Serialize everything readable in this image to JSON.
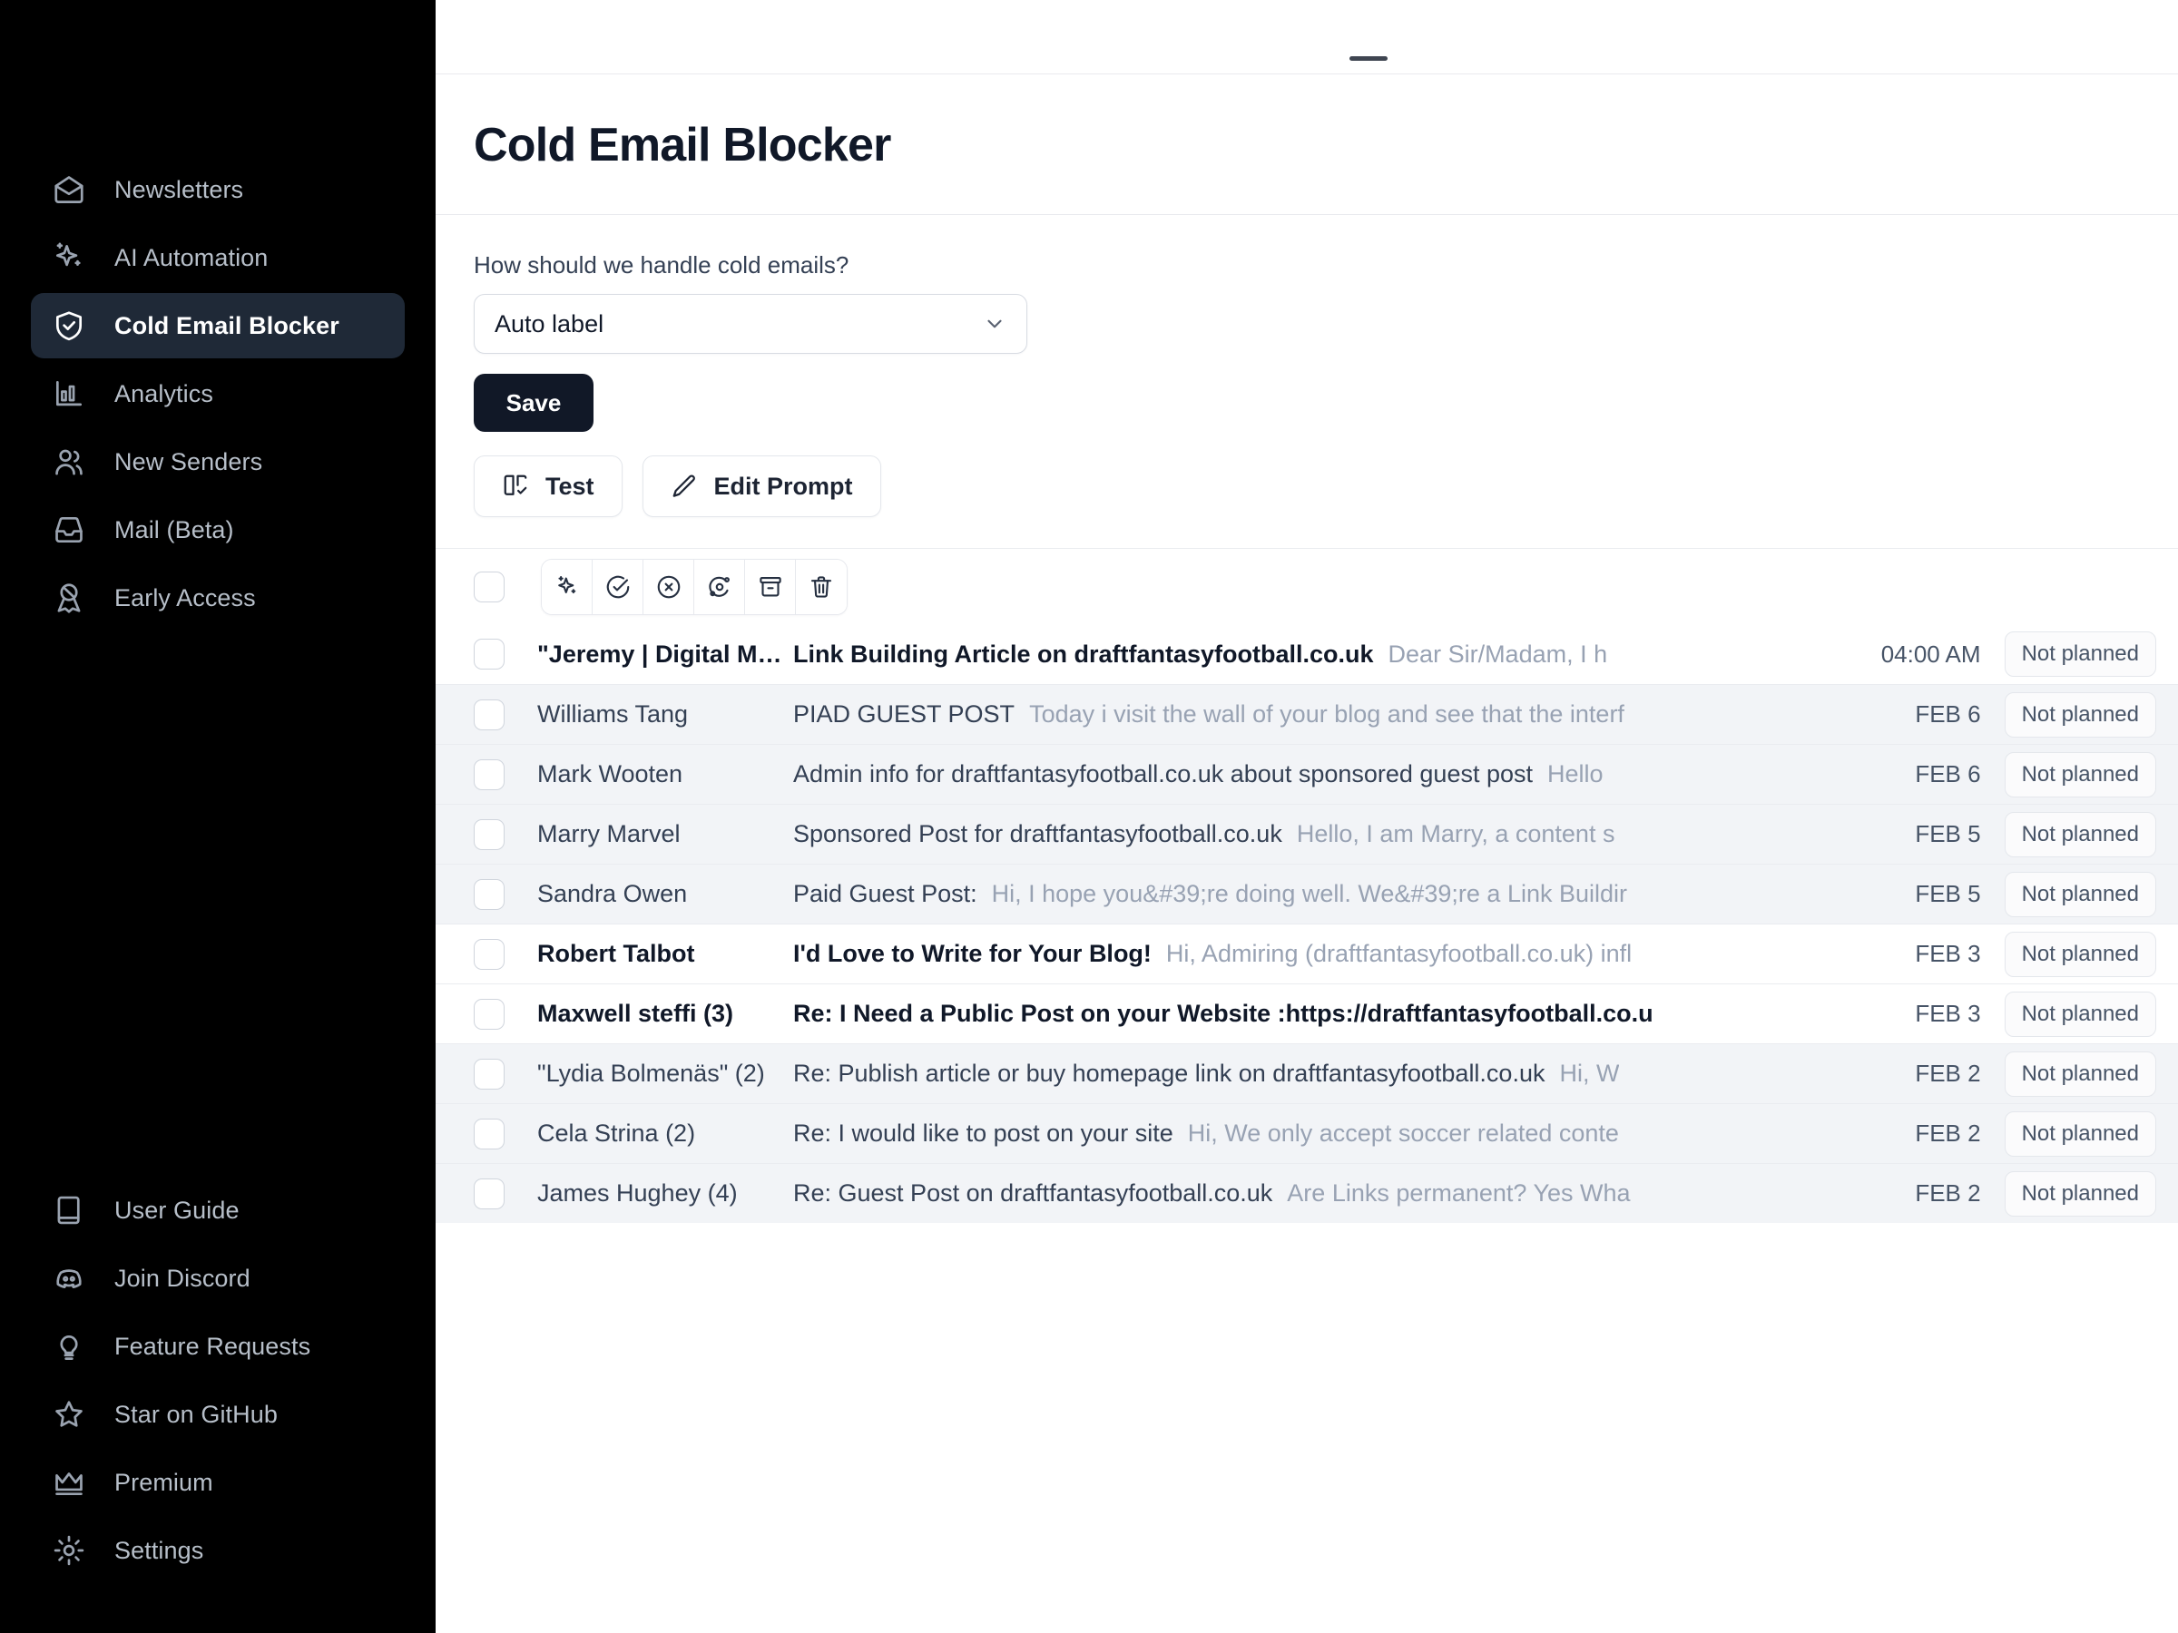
{
  "sidebar": {
    "top_items": [
      {
        "label": "Newsletters",
        "icon": "mail-open-icon",
        "active": false
      },
      {
        "label": "AI Automation",
        "icon": "sparkles-icon",
        "active": false
      },
      {
        "label": "Cold Email Blocker",
        "icon": "shield-check-icon",
        "active": true
      },
      {
        "label": "Analytics",
        "icon": "bar-chart-icon",
        "active": false
      },
      {
        "label": "New Senders",
        "icon": "users-icon",
        "active": false
      },
      {
        "label": "Mail (Beta)",
        "icon": "inbox-icon",
        "active": false
      },
      {
        "label": "Early Access",
        "icon": "ribbon-icon",
        "active": false
      }
    ],
    "bottom_items": [
      {
        "label": "User Guide",
        "icon": "book-icon"
      },
      {
        "label": "Join Discord",
        "icon": "discord-icon"
      },
      {
        "label": "Feature Requests",
        "icon": "lightbulb-icon"
      },
      {
        "label": "Star on GitHub",
        "icon": "star-icon"
      },
      {
        "label": "Premium",
        "icon": "crown-icon"
      },
      {
        "label": "Settings",
        "icon": "gear-icon"
      }
    ]
  },
  "header": {
    "title": "Cold Email Blocker"
  },
  "controls": {
    "field_label": "How should we handle cold emails?",
    "select_value": "Auto label",
    "select_options": [
      "Auto label"
    ],
    "save_label": "Save",
    "test_label": "Test",
    "edit_prompt_label": "Edit Prompt"
  },
  "toolbar": {
    "select_all_checked": false,
    "actions": [
      {
        "name": "ai-categorize-icon",
        "title": "AI"
      },
      {
        "name": "mark-done-icon",
        "title": "Mark done"
      },
      {
        "name": "mark-not-done-icon",
        "title": "Not done"
      },
      {
        "name": "mark-spam-icon",
        "title": "Spam"
      },
      {
        "name": "archive-icon",
        "title": "Archive"
      },
      {
        "name": "trash-icon",
        "title": "Delete"
      }
    ]
  },
  "emails": [
    {
      "sender": "\"Jeremy | Digital Mastermi...",
      "subject": "Link Building Article on draftfantasyfootball.co.uk",
      "snippet": "Dear Sir/Madam, I h",
      "date": "04:00 AM",
      "status": "Not planned",
      "unread": true,
      "shaded": false
    },
    {
      "sender": "Williams Tang",
      "subject": "PIAD GUEST POST",
      "snippet": "Today i visit the wall of your blog and see that the interf",
      "date": "FEB 6",
      "status": "Not planned",
      "unread": false,
      "shaded": true
    },
    {
      "sender": "Mark Wooten",
      "subject": "Admin info for draftfantasyfootball.co.uk about sponsored guest post",
      "snippet": "Hello",
      "date": "FEB 6",
      "status": "Not planned",
      "unread": false,
      "shaded": true
    },
    {
      "sender": "Marry Marvel",
      "subject": "Sponsored Post for draftfantasyfootball.co.uk",
      "snippet": "Hello, I am Marry, a content s",
      "date": "FEB 5",
      "status": "Not planned",
      "unread": false,
      "shaded": true
    },
    {
      "sender": "Sandra Owen",
      "subject": "Paid Guest Post:",
      "snippet": "Hi, I hope you&#39;re doing well. We&#39;re a Link Buildir",
      "date": "FEB 5",
      "status": "Not planned",
      "unread": false,
      "shaded": true
    },
    {
      "sender": "Robert Talbot",
      "subject": "I'd Love to Write for Your Blog!",
      "snippet": "Hi, Admiring (draftfantasyfootball.co.uk) infl",
      "date": "FEB 3",
      "status": "Not planned",
      "unread": true,
      "shaded": false
    },
    {
      "sender": "Maxwell steffi (3)",
      "subject": "Re: I Need a Public Post on your Website :https://draftfantasyfootball.co.u",
      "snippet": "",
      "date": "FEB 3",
      "status": "Not planned",
      "unread": true,
      "shaded": false
    },
    {
      "sender": "\"Lydia Bolmenäs\" (2)",
      "subject": "Re: Publish article or buy homepage link on draftfantasyfootball.co.uk",
      "snippet": "Hi, W",
      "date": "FEB 2",
      "status": "Not planned",
      "unread": false,
      "shaded": true
    },
    {
      "sender": "Cela Strina (2)",
      "subject": "Re: I would like to post on your site",
      "snippet": "Hi, We only accept soccer related conte",
      "date": "FEB 2",
      "status": "Not planned",
      "unread": false,
      "shaded": true
    },
    {
      "sender": "James Hughey (4)",
      "subject": "Re: Guest Post on draftfantasyfootball.co.uk",
      "snippet": "Are Links permanent? Yes Wha",
      "date": "FEB 2",
      "status": "Not planned",
      "unread": false,
      "shaded": true
    }
  ],
  "colors": {
    "sidebar_bg": "#000000",
    "sidebar_active_bg": "#1f2937",
    "accent_dark": "#111827",
    "row_shaded": "#f2f4f7",
    "text_muted": "#98a2b3"
  }
}
